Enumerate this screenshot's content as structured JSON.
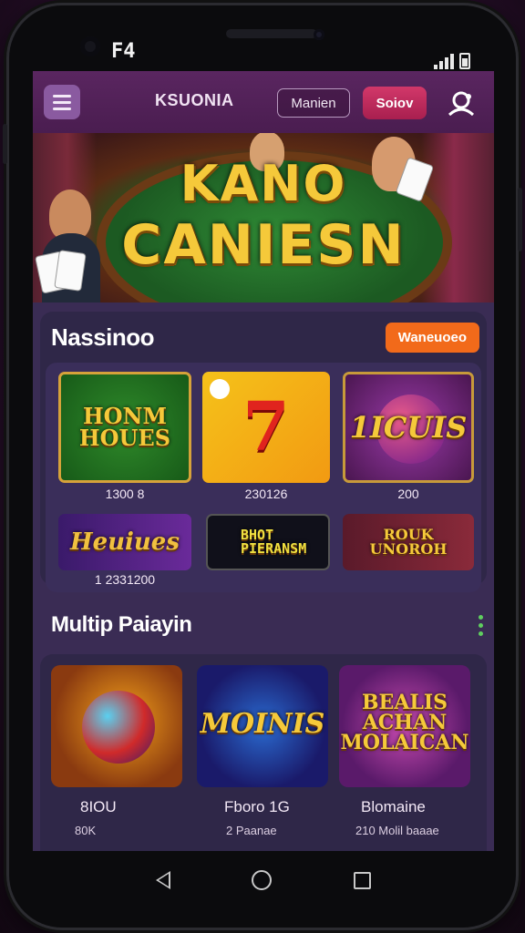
{
  "status_bar": {
    "time": "F4"
  },
  "app_bar": {
    "brand": "KSUONIA",
    "login_label": "Manien",
    "signup_label": "Soiov"
  },
  "hero": {
    "title_line1": "KANO",
    "title_line2": "CANIESN"
  },
  "section1": {
    "title": "Nassinoo",
    "view_all_label": "Waneuoeo",
    "games": [
      {
        "title": "HONM HOUES",
        "label": "1300 8"
      },
      {
        "title": "7",
        "label": "230126"
      },
      {
        "title": "1ICUIS",
        "label": "200"
      },
      {
        "title": "Heuiues",
        "label": "1 2331200"
      },
      {
        "title": "BHOT PIERANSM",
        "label": ""
      },
      {
        "title": "ROUK UNOROH",
        "label": ""
      }
    ]
  },
  "section2": {
    "title": "Multip Paiayin",
    "games": [
      {
        "title": "",
        "name": "8IOU",
        "sub": "80K"
      },
      {
        "title": "MOINIS",
        "name": "Fboro 1G",
        "sub": "2 Paanae"
      },
      {
        "title": "BEALIS ACHAN MOLAICAN",
        "name": "Blomaine",
        "sub": "210 Molil baaae"
      }
    ]
  },
  "colors": {
    "accent_orange": "#f26a1a",
    "signup_pink": "#c42c5c",
    "panel": "#2f2748",
    "appbar": "#52215a"
  }
}
